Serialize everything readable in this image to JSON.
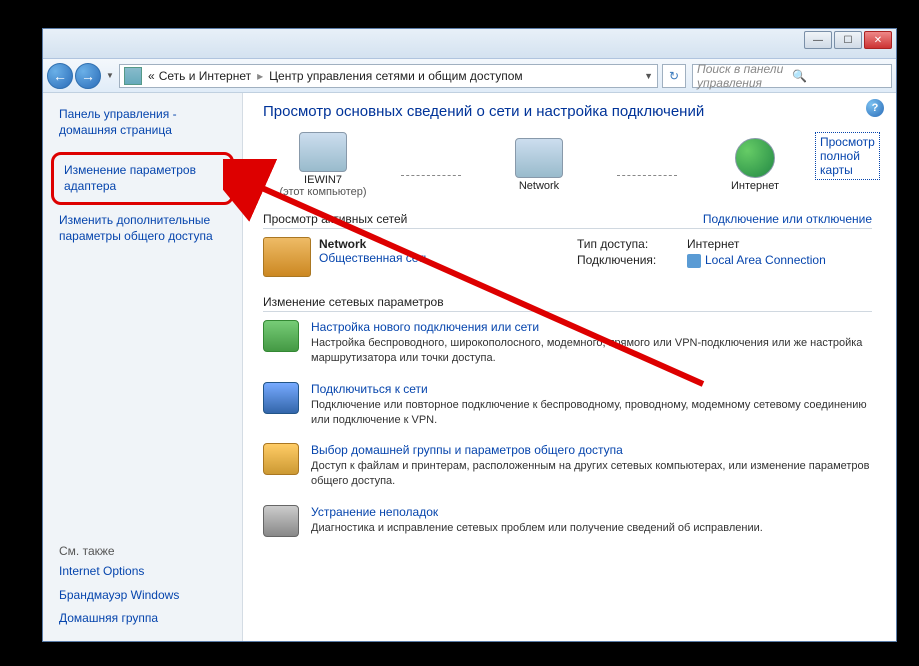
{
  "titlebar": {
    "minimize": "—",
    "maximize": "☐",
    "close": "✕"
  },
  "nav": {
    "back_glyph": "←",
    "forward_glyph": "→",
    "crumb_prefix": "«",
    "crumb1": "Сеть и Интернет",
    "crumb2": "Центр управления сетями и общим доступом",
    "refresh_glyph": "↻",
    "search_placeholder": "Поиск в панели управления"
  },
  "sidebar": {
    "home": "Панель управления - домашняя страница",
    "adapter": "Изменение параметров адаптера",
    "advanced": "Изменить дополнительные параметры общего доступа",
    "seealso_label": "См. также",
    "links": {
      "internet_options": "Internet Options",
      "firewall": "Брандмауэр Windows",
      "homegroup": "Домашняя группа"
    }
  },
  "main": {
    "heading": "Просмотр основных сведений о сети и настройка подключений",
    "full_map": "Просмотр полной карты",
    "topology": {
      "node1_label": "IEWIN7",
      "node1_sub": "(этот компьютер)",
      "node2_label": "Network",
      "node3_label": "Интернет"
    },
    "active_nets_header": "Просмотр активных сетей",
    "connect_action": "Подключение или отключение",
    "network": {
      "name": "Network",
      "type": "Общественная сеть",
      "access_label": "Тип доступа:",
      "access_value": "Интернет",
      "conn_label": "Подключения:",
      "conn_value": "Local Area Connection"
    },
    "settings_header": "Изменение сетевых параметров",
    "settings": [
      {
        "title": "Настройка нового подключения или сети",
        "desc": "Настройка беспроводного, широкополосного, модемного, прямого или VPN-подключения или же настройка маршрутизатора или точки доступа."
      },
      {
        "title": "Подключиться к сети",
        "desc": "Подключение или повторное подключение к беспроводному, проводному, модемному сетевому соединению или подключение к VPN."
      },
      {
        "title": "Выбор домашней группы и параметров общего доступа",
        "desc": "Доступ к файлам и принтерам, расположенным на других сетевых компьютерах, или изменение параметров общего доступа."
      },
      {
        "title": "Устранение неполадок",
        "desc": "Диагностика и исправление сетевых проблем или получение сведений об исправлении."
      }
    ]
  }
}
